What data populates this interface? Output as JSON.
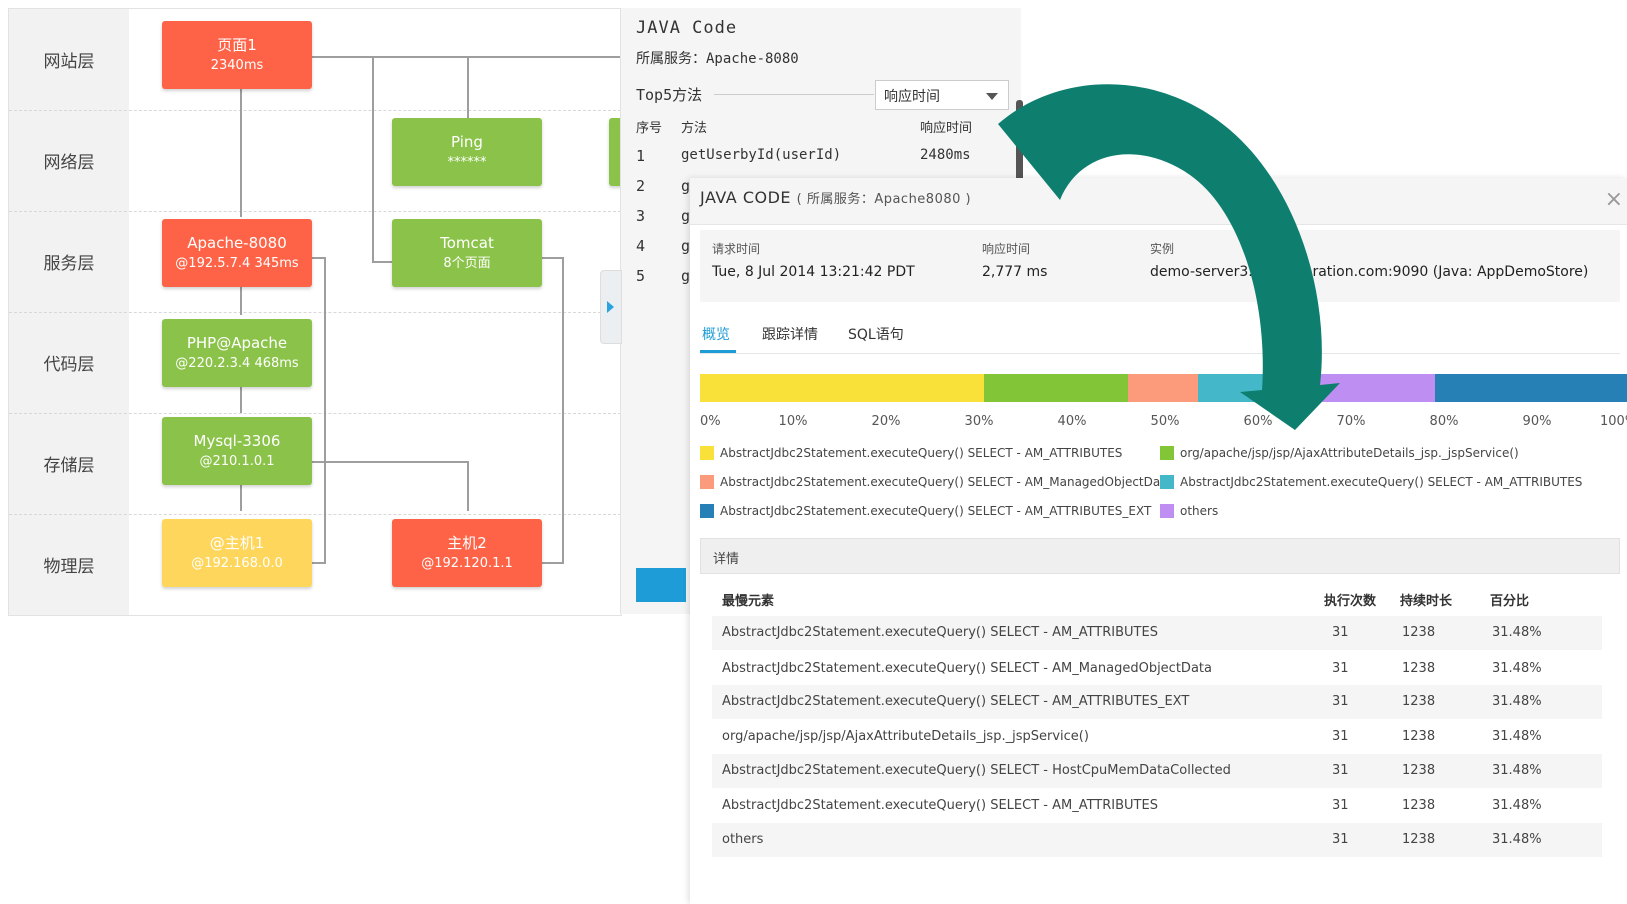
{
  "topology": {
    "layers": [
      "网站层",
      "网络层",
      "服务层",
      "代码层",
      "存储层",
      "物理层"
    ],
    "nodes": {
      "page1": {
        "name": "页面1",
        "detail": "2340ms"
      },
      "ping": {
        "name": "Ping",
        "detail": "******"
      },
      "apache": {
        "name": "Apache-8080",
        "detail": "@192.5.7.4 345ms"
      },
      "tomcat": {
        "name": "Tomcat",
        "detail": "8个页面"
      },
      "php": {
        "name": "PHP@Apache",
        "detail": "@220.2.3.4 468ms"
      },
      "mysql": {
        "name": "Mysql-3306",
        "detail": "@210.1.0.1"
      },
      "host1": {
        "name": "@主机1",
        "detail": "@192.168.0.0"
      },
      "host2": {
        "name": "主机2",
        "detail": "@192.120.1.1"
      }
    },
    "colors": {
      "red": "#ff6347",
      "green": "#8bc34a",
      "yellow": "#ffd65c"
    }
  },
  "code_panel": {
    "title": "JAVA Code",
    "service": "所属服务：Apache-8080",
    "top5_label": "Top5方法",
    "sort_select": "响应时间",
    "columns": {
      "idx": "序号",
      "method": "方法",
      "time": "响应时间"
    },
    "row1": {
      "idx": "1",
      "method": "getUserbyId(userId)",
      "time": "2480ms"
    },
    "visible_indices": [
      "2",
      "3",
      "4",
      "5"
    ],
    "partial_method_char": "g"
  },
  "dialog": {
    "title": "JAVA CODE",
    "subtitle": "( 所属服务：Apache8080 )",
    "close": "×",
    "info": {
      "request_time_label": "请求时间",
      "request_time": "Tue, 8 Jul 2014 13:21:42 PDT",
      "response_time_label": "响应时间",
      "response_time": "2,777 ms",
      "instance_label": "实例",
      "instance_left": "demo-server3.",
      "instance_right": "poration.com:9090 (Java: AppDemoStore)"
    },
    "tabs": [
      "概览",
      "跟踪详情",
      "SQL语句"
    ],
    "axis_ticks": [
      "0%",
      "10%",
      "20%",
      "30%",
      "40%",
      "50%",
      "60%",
      "70%",
      "80%",
      "90%",
      "100%"
    ],
    "breakdown": [
      {
        "label": "AbstractJdbc2Statement.executeQuery() SELECT - AM_ATTRIBUTES",
        "share": 0.305,
        "color": "#fae13a"
      },
      {
        "label": "org/apache/jsp/jsp/AjaxAttributeDetails_jsp._jspService()",
        "share": 0.155,
        "color": "#82c638"
      },
      {
        "label": "AbstractJdbc2Statement.executeQuery() SELECT - AM_ManagedObjectData",
        "share": 0.075,
        "color": "#fb9b7b"
      },
      {
        "label": "AbstractJdbc2Statement.executeQuery() SELECT - AM_ATTRIBUTES",
        "share": 0.075,
        "color": "#44b8c8"
      },
      {
        "label": "AbstractJdbc2Statement.executeQuery() SELECT - AM_ATTRIBUTES_EXT",
        "share": 0.0,
        "color": "#2680b6"
      },
      {
        "label": "others",
        "share": 0.18,
        "color": "#bf8ef2"
      }
    ],
    "bar_tail_share": 0.21,
    "bar_tail_color": "#2680b6",
    "detail_header": "详情",
    "table": {
      "headers": [
        "最慢元素",
        "执行次数",
        "持续时长",
        "百分比"
      ],
      "rows": [
        [
          "AbstractJdbc2Statement.executeQuery() SELECT - AM_ATTRIBUTES",
          "31",
          "1238",
          "31.48%"
        ],
        [
          "AbstractJdbc2Statement.executeQuery() SELECT - AM_ManagedObjectData",
          "31",
          "1238",
          "31.48%"
        ],
        [
          "AbstractJdbc2Statement.executeQuery() SELECT - AM_ATTRIBUTES_EXT",
          "31",
          "1238",
          "31.48%"
        ],
        [
          "org/apache/jsp/jsp/AjaxAttributeDetails_jsp._jspService()",
          "31",
          "1238",
          "31.48%"
        ],
        [
          "AbstractJdbc2Statement.executeQuery() SELECT - HostCpuMemDataCollected",
          "31",
          "1238",
          "31.48%"
        ],
        [
          "AbstractJdbc2Statement.executeQuery() SELECT - AM_ATTRIBUTES",
          "31",
          "1238",
          "31.48%"
        ],
        [
          "others",
          "31",
          "1238",
          "31.48%"
        ]
      ]
    }
  },
  "arrow_color": "#0e7f6f"
}
